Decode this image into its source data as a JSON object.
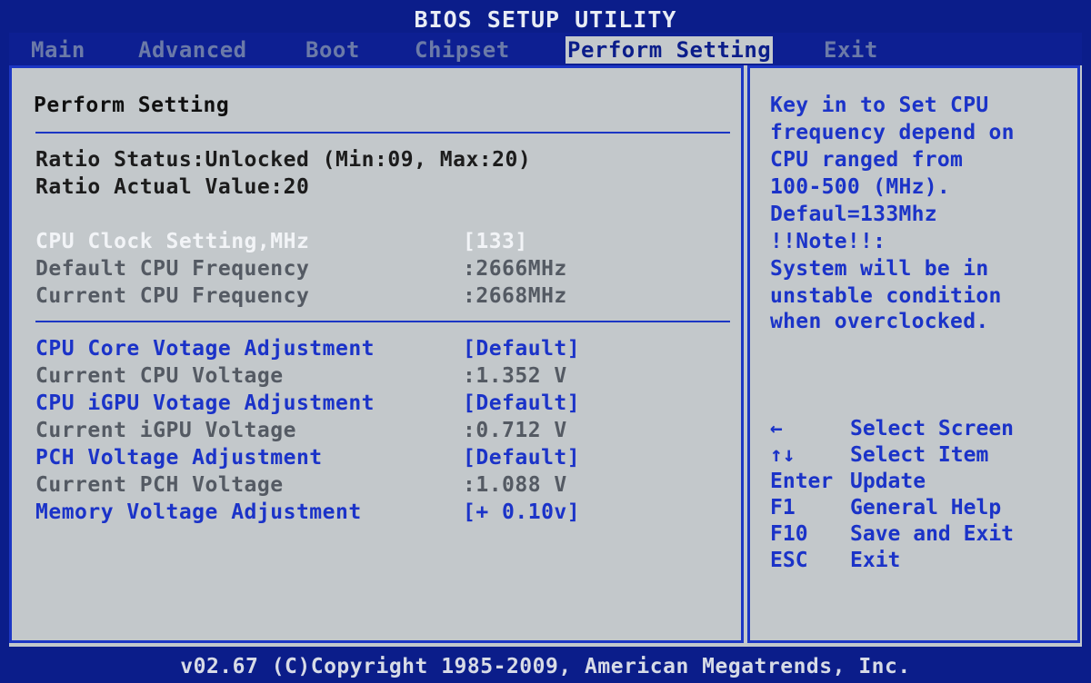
{
  "title": "BIOS SETUP UTILITY",
  "menu": {
    "items": [
      {
        "label": "Main"
      },
      {
        "label": "Advanced"
      },
      {
        "label": "Boot"
      },
      {
        "label": "Chipset"
      },
      {
        "label": "Perform Setting"
      },
      {
        "label": "Exit"
      }
    ],
    "active_index": 4
  },
  "panel": {
    "heading": "Perform Setting",
    "ratio_status": "Ratio Status:Unlocked (Min:09, Max:20)",
    "ratio_actual": "Ratio Actual Value:20",
    "cpu_clock": {
      "label": "CPU Clock Setting,MHz",
      "value": "[133]"
    },
    "default_freq": {
      "label": "Default CPU Frequency",
      "value": ":2666MHz"
    },
    "current_freq": {
      "label": "Current CPU Frequency",
      "value": ":2668MHz"
    },
    "cpu_core_volt_adj": {
      "label": "CPU Core Votage Adjustment",
      "value": "[Default]"
    },
    "current_cpu_volt": {
      "label": "Current CPU Voltage",
      "value": ":1.352 V"
    },
    "igpu_volt_adj": {
      "label": "CPU iGPU Votage Adjustment",
      "value": "[Default]"
    },
    "current_igpu_volt": {
      "label": "Current iGPU Voltage",
      "value": ":0.712 V"
    },
    "pch_volt_adj": {
      "label": "PCH Voltage Adjustment",
      "value": "[Default]"
    },
    "current_pch_volt": {
      "label": "Current PCH Voltage",
      "value": ":1.088 V"
    },
    "mem_volt_adj": {
      "label": "Memory Voltage Adjustment",
      "value": "[+ 0.10v]"
    }
  },
  "help": {
    "lines": [
      "Key in to Set CPU",
      "frequency depend on",
      "CPU ranged from",
      "100-500 (MHz).",
      "Defaul=133Mhz",
      "!!Note!!:",
      "System will be in",
      "unstable condition",
      "when overclocked."
    ]
  },
  "keys": [
    {
      "key": "←",
      "desc": "Select Screen"
    },
    {
      "key": "↑↓",
      "desc": "Select Item"
    },
    {
      "key": "Enter",
      "desc": "Update"
    },
    {
      "key": "F1",
      "desc": "General Help"
    },
    {
      "key": "F10",
      "desc": "Save and Exit"
    },
    {
      "key": "ESC",
      "desc": "Exit"
    }
  ],
  "footer": "v02.67 (C)Copyright 1985-2009, American Megatrends, Inc.",
  "colors": {
    "background": "#0b1d8a",
    "panel": "#c3c8cb",
    "accent_blue": "#1b33c8",
    "highlight_white": "#f2f4f7"
  }
}
